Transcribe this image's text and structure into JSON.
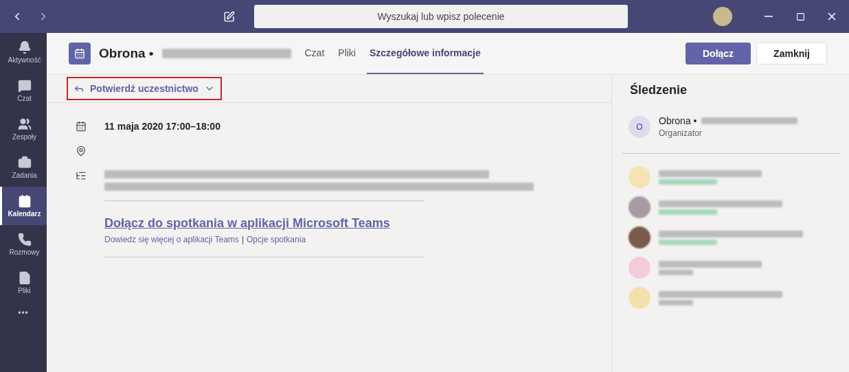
{
  "titlebar": {
    "search": {
      "placeholder": "Wyszukaj lub wpisz polecenie"
    }
  },
  "sidebar": {
    "items": [
      {
        "label": "Aktywność",
        "selected": false
      },
      {
        "label": "Czat",
        "selected": false
      },
      {
        "label": "Zespoły",
        "selected": false
      },
      {
        "label": "Zadania",
        "selected": false
      },
      {
        "label": "Kalendarz",
        "selected": true
      },
      {
        "label": "Rozmowy",
        "selected": false
      },
      {
        "label": "Pliki",
        "selected": false
      }
    ],
    "more": "•••"
  },
  "header": {
    "title": "Obrona •",
    "tabs": [
      {
        "label": "Czat",
        "selected": false
      },
      {
        "label": "Pliki",
        "selected": false
      },
      {
        "label": "Szczegółowe informacje",
        "selected": true
      }
    ],
    "buttons": [
      {
        "label": "Dołącz",
        "kind": "primary"
      },
      {
        "label": "Zamknij",
        "kind": "secondary"
      }
    ]
  },
  "rsvp": {
    "label": "Potwierdź uczestnictwo",
    "highlighted": true
  },
  "details": {
    "date": "11 maja 2020 17:00–18:00",
    "join_link": "Dołącz do spotkania w aplikacji Microsoft Teams",
    "links": [
      "Dowiedz się więcej o aplikacji Teams",
      "Opcje spotkania"
    ],
    "separator": "|"
  },
  "tracking": {
    "title": "Śledzenie",
    "organizer": {
      "initial": "O",
      "name": "Obrona •",
      "role": "Organizator"
    },
    "attendees": [
      {
        "kind": "initials",
        "color": "#f6e3b3",
        "accepted": true
      },
      {
        "kind": "photo",
        "color": "#a79aa5",
        "accepted": true
      },
      {
        "kind": "photo",
        "color": "#7a5a48",
        "accepted": true
      },
      {
        "kind": "initials",
        "color": "#f3cbdc",
        "accepted": false
      },
      {
        "kind": "initials",
        "color": "#f3e1ad",
        "accepted": false
      }
    ]
  }
}
